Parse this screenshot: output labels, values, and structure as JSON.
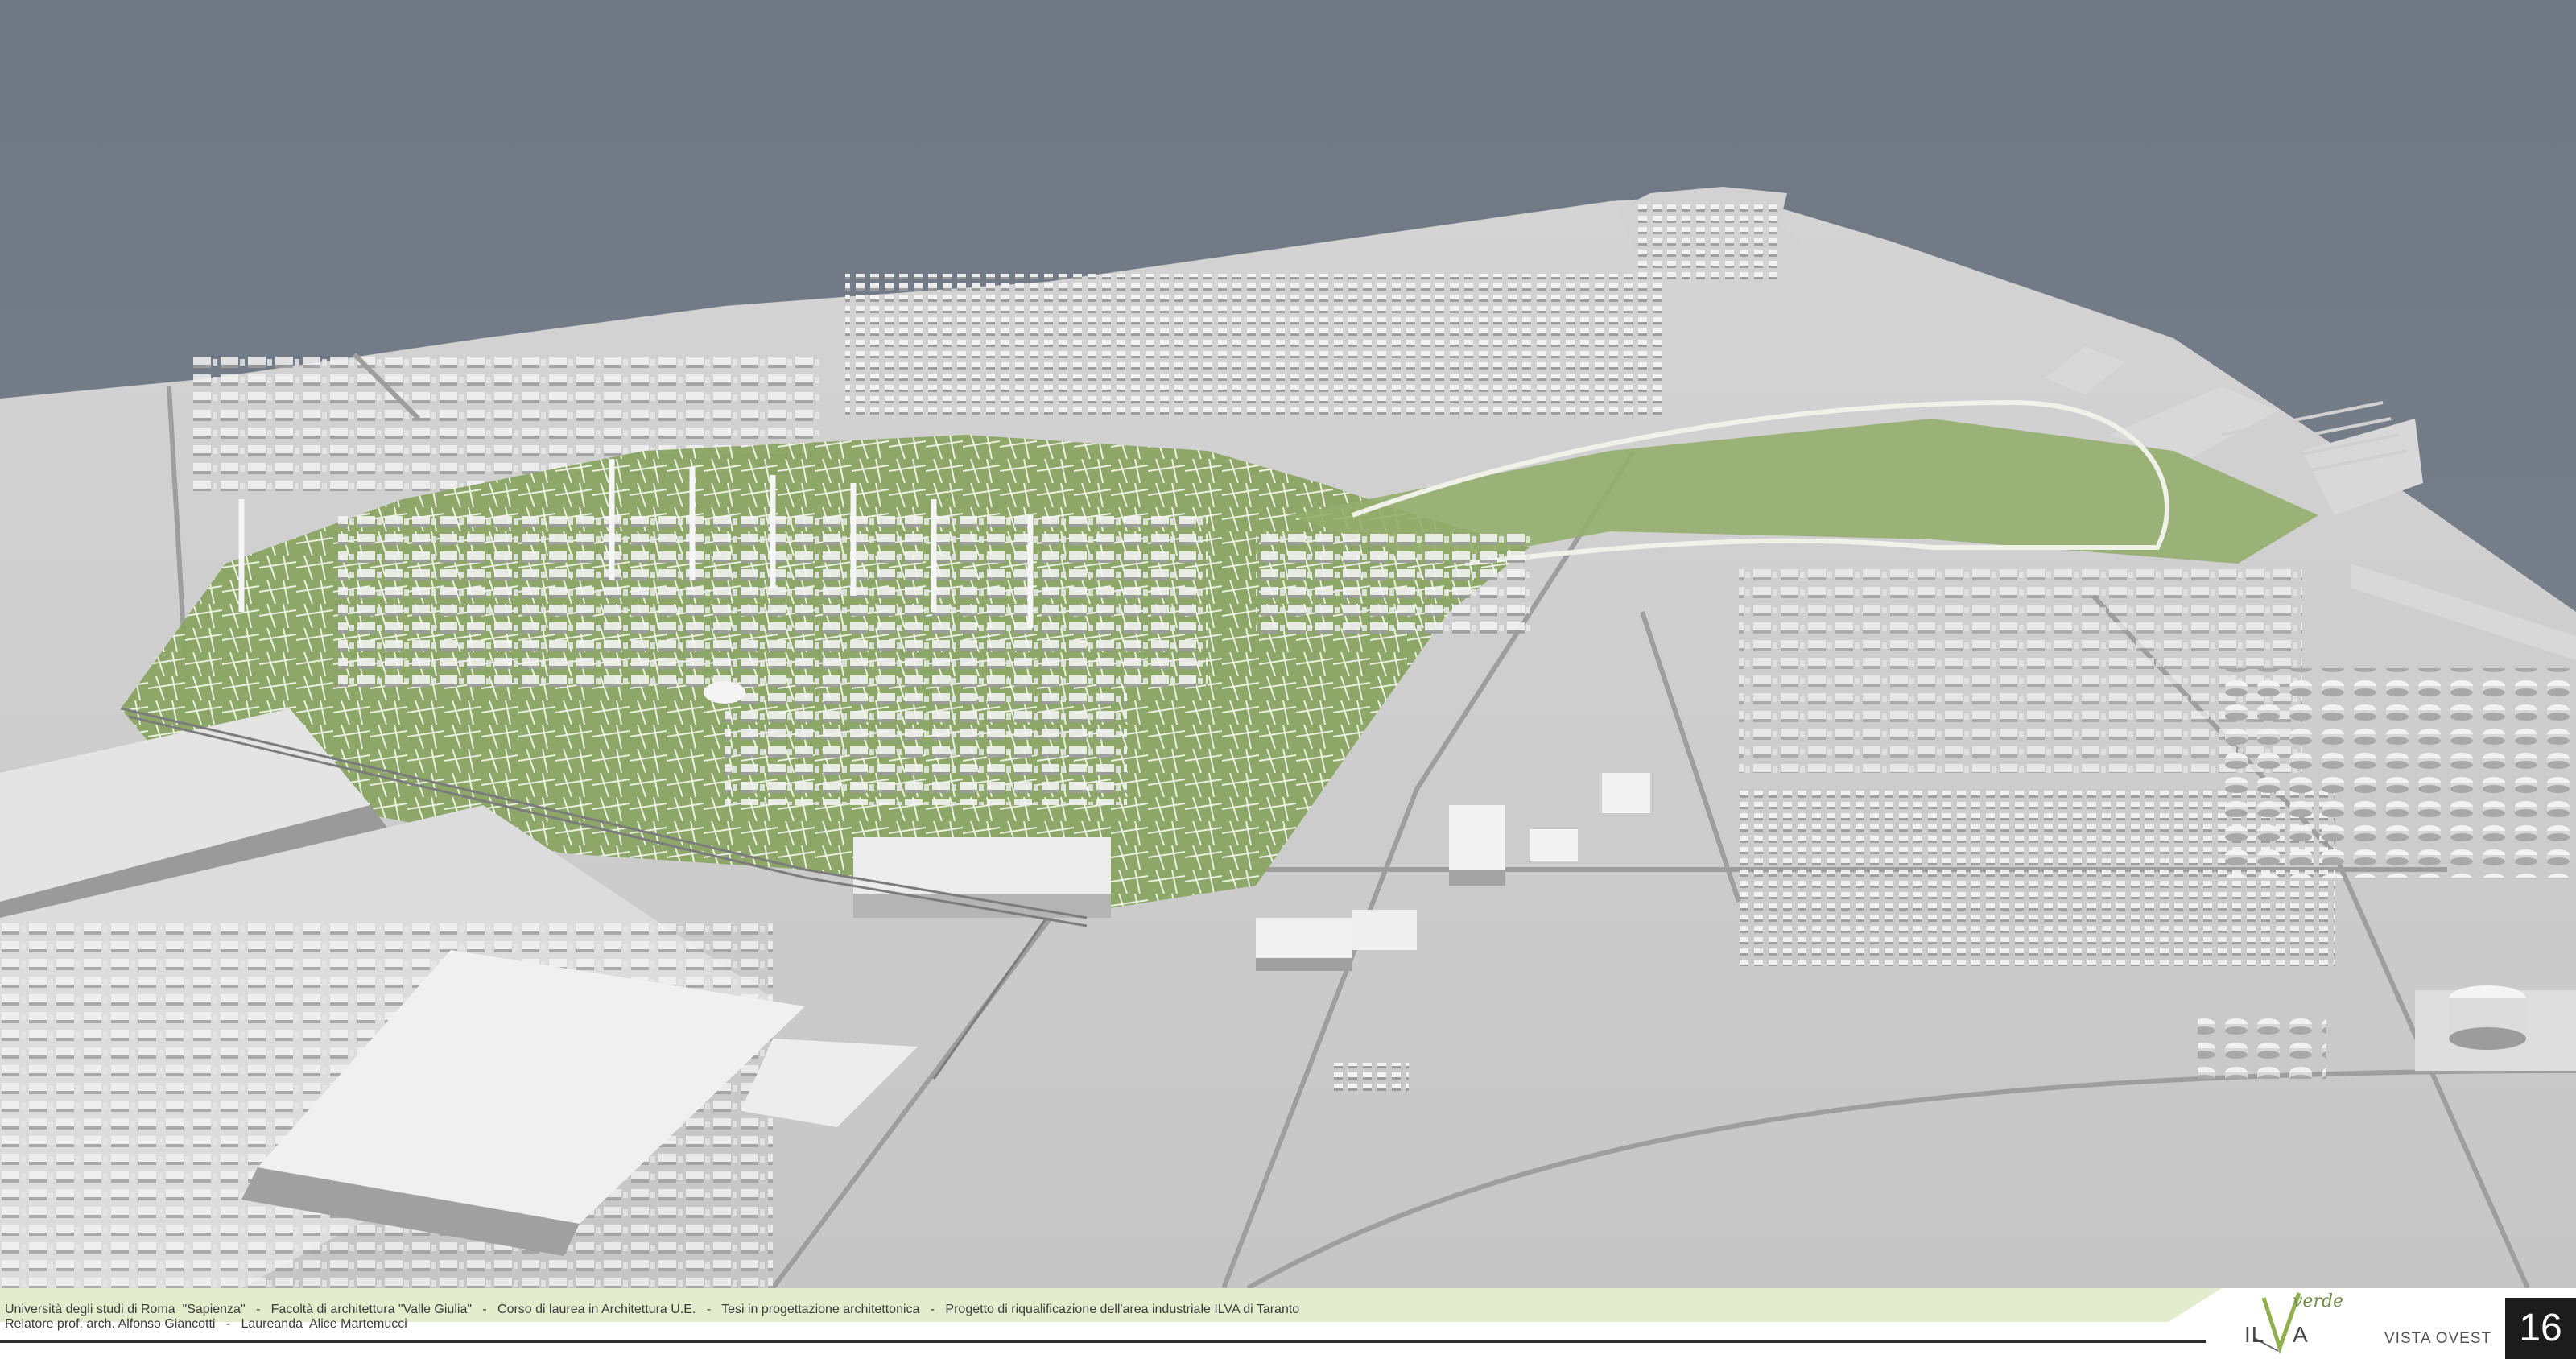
{
  "footer": {
    "credits_line_1": "Università degli studi di Roma  \"Sapienza\"   -   Facoltà di architettura \"Valle Giulia\"   -   Corso di laurea in Architettura U.E.   -   Tesi in progettazione architettonica   -   Progetto di riqualificazione dell'area industriale ILVA di Taranto",
    "credits_line_2": "Relatore prof. arch. Alfonso Giancotti   -   Laureanda  Alice Martemucci",
    "logo": {
      "text_main_left": "IL",
      "text_main_right": "A",
      "text_script": "verde",
      "mark": "V"
    },
    "view_label": "VISTA OVEST",
    "page_number": "16"
  },
  "colors": {
    "sea": "#78808c",
    "land": "#cfcfcf",
    "green_park": "#8aa564",
    "band": "#e3eccd",
    "page_box": "#1c1c1c"
  }
}
